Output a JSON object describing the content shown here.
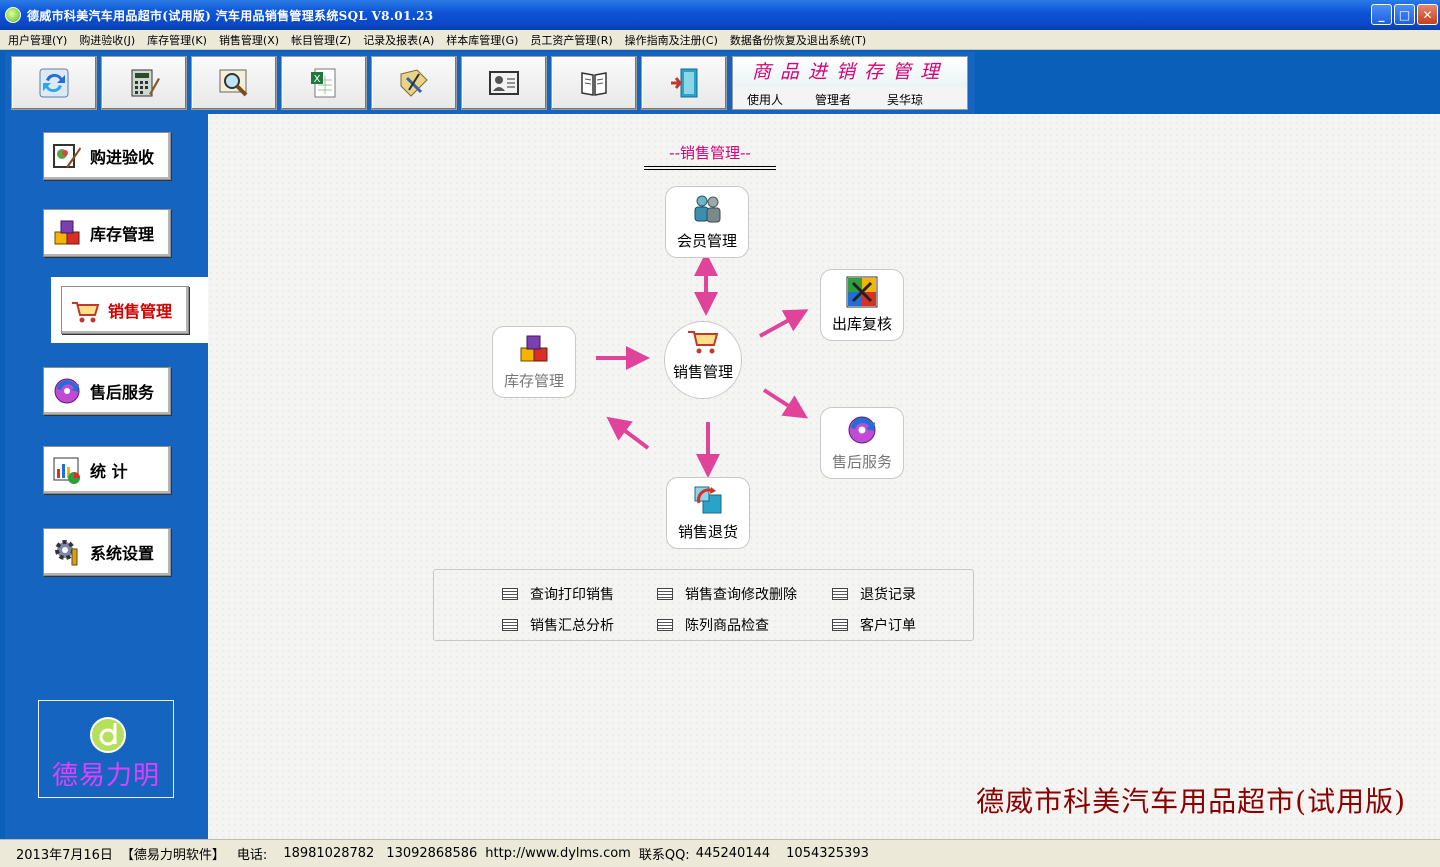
{
  "window": {
    "title": "德威市科美汽车用品超市(试用版) 汽车用品销售管理系统SQL V8.01.23",
    "minimize": "_",
    "maximize": "□",
    "close": "✕"
  },
  "menu": [
    "用户管理(Y)",
    "购进验收(J)",
    "库存管理(K)",
    "销售管理(X)",
    "帐目管理(Z)",
    "记录及报表(A)",
    "样本库管理(G)",
    "员工资产管理(R)",
    "操作指南及注册(C)",
    "数据备份恢复及退出系统(T)"
  ],
  "toolbar": {
    "icons": [
      "refresh-icon",
      "calculator-icon",
      "search-icon",
      "excel-icon",
      "tools-icon",
      "user-card-icon",
      "book-icon",
      "exit-door-icon"
    ],
    "brand_title": "商品进销存管理",
    "user_label": "使用人",
    "role": "管理者",
    "user_name": "吴华琼"
  },
  "sidebar": {
    "items": [
      {
        "label": "购进验收",
        "icon": "purchase-icon",
        "active": false
      },
      {
        "label": "库存管理",
        "icon": "cubes-icon",
        "active": false
      },
      {
        "label": "销售管理",
        "icon": "cart-icon",
        "active": true
      },
      {
        "label": "售后服务",
        "icon": "cd-icon",
        "active": false
      },
      {
        "label": "统  计",
        "icon": "chart-icon",
        "active": false
      },
      {
        "label": "系统设置",
        "icon": "gear-icon",
        "active": false
      }
    ],
    "logo_text": "德易力明"
  },
  "main": {
    "section_title": "--销售管理--",
    "nodes": {
      "member": "会员管理",
      "inventory": "库存管理",
      "sales": "销售管理",
      "outbound_review": "出库复核",
      "after_sales": "售后服务",
      "sales_return": "销售退货"
    },
    "links": [
      "查询打印销售",
      "销售查询修改删除",
      "退货记录",
      "销售汇总分析",
      "陈列商品检查",
      "客户订单"
    ],
    "company": "德威市科美汽车用品超市(试用版)"
  },
  "status": {
    "date": "2013年7月16日",
    "vendor": "【德易力明软件】",
    "phone_label": "电话:",
    "phone1": "18981028782",
    "phone2": "13092868586",
    "url": "http://www.dylms.com",
    "qq_label": "联系QQ:",
    "qq1": "445240144",
    "qq2": "1054325393"
  },
  "colors": {
    "accent_pink": "#d5007a",
    "sidebar_blue": "#1565c0",
    "company_red": "#8b0000",
    "arrow_pink": "#e0449a"
  }
}
